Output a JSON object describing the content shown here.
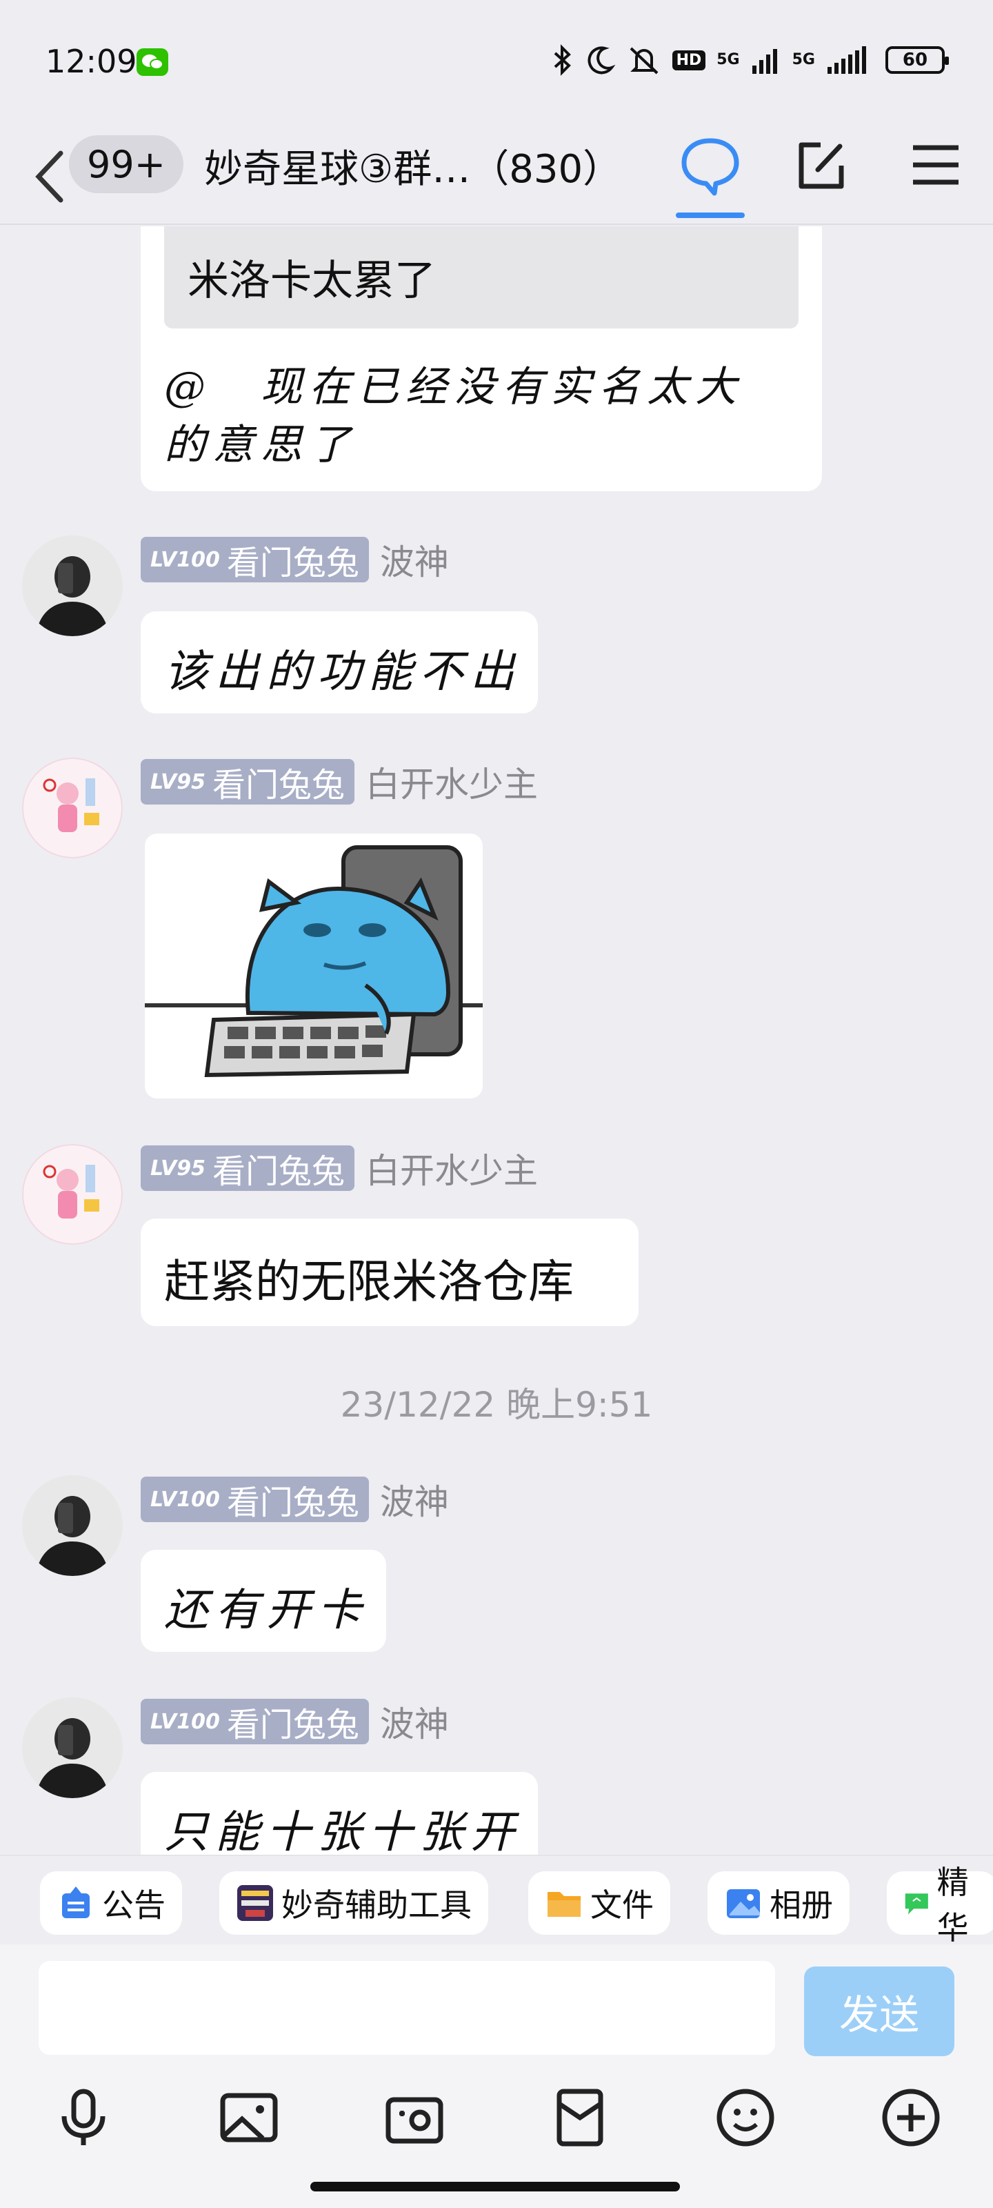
{
  "status_bar": {
    "time": "12:09",
    "hd_label": "HD",
    "net1": "5G",
    "net2": "5G",
    "battery": "60"
  },
  "nav": {
    "unread": "99+",
    "title": "妙奇星球③群…（830）"
  },
  "messages": {
    "quoted_text": "米洛卡太累了",
    "reply_text_line1": "@　现在已经没有实名太大",
    "reply_text_line2": "的意思了",
    "m1": {
      "lv": "LV100",
      "tag": "看门兔兔",
      "sender": "波神",
      "text": "该出的功能不出"
    },
    "m2": {
      "lv": "LV95",
      "tag": "看门兔兔",
      "sender": "白开水少主"
    },
    "m3": {
      "lv": "LV95",
      "tag": "看门兔兔",
      "sender": "白开水少主",
      "text": "赶紧的无限米洛仓库"
    },
    "timestamp": "23/12/22 晚上9:51",
    "m4": {
      "lv": "LV100",
      "tag": "看门兔兔",
      "sender": "波神",
      "text": "还有开卡"
    },
    "m5": {
      "lv": "LV100",
      "tag": "看门兔兔",
      "sender": "波神",
      "text": "只能十张十张开"
    }
  },
  "quick_actions": [
    "公告",
    "妙奇辅助工具",
    "文件",
    "相册",
    "精华"
  ],
  "input": {
    "placeholder": "",
    "send_label": "发送"
  },
  "colors": {
    "accent": "#3a8cf5",
    "send_disabled": "#9ccff8",
    "level_tag": "#a8aec6"
  }
}
